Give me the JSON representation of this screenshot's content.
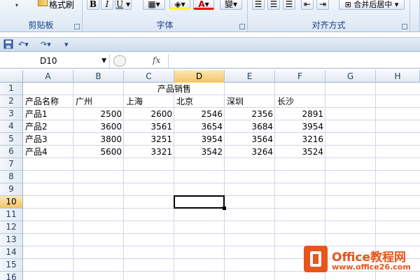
{
  "ribbon": {
    "clipboard_group": "剪贴板",
    "format_painter_label": "格式刷",
    "font_group": "字体",
    "align_group": "对齐方式",
    "merge_center_label": "合并后居中",
    "bold": "B",
    "italic": "I",
    "underline": "U",
    "font_color_letter": "A",
    "phonetic": "變"
  },
  "qat": {
    "save_icon": "save-icon",
    "undo_icon": "undo-icon",
    "redo_icon": "redo-icon"
  },
  "formula_bar": {
    "name_box": "D10",
    "fx_label": "fx",
    "formula": ""
  },
  "columns": [
    "A",
    "B",
    "C",
    "D",
    "E",
    "F",
    "G",
    "H"
  ],
  "rows": [
    "1",
    "2",
    "3",
    "4",
    "5",
    "6",
    "7",
    "8",
    "9",
    "10",
    "11",
    "12",
    "13",
    "14",
    "15",
    "16"
  ],
  "active_cell": {
    "column": "D",
    "row": "10"
  },
  "sheet": {
    "title": "产品销售",
    "header": [
      "产品名称",
      "广州",
      "上海",
      "北京",
      "深圳",
      "长沙"
    ],
    "data": [
      {
        "name": "产品1",
        "values": [
          "2500",
          "2600",
          "2546",
          "2356",
          "2891"
        ]
      },
      {
        "name": "产品2",
        "values": [
          "3600",
          "3561",
          "3654",
          "3684",
          "3954"
        ]
      },
      {
        "name": "产品3",
        "values": [
          "3800",
          "3251",
          "3954",
          "3564",
          "3216"
        ]
      },
      {
        "name": "产品4",
        "values": [
          "5600",
          "3321",
          "3542",
          "3264",
          "3524"
        ]
      }
    ]
  },
  "watermark": {
    "title": "Office教程网",
    "url": "www.office26.com"
  },
  "colors": {
    "ribbon_text": "#15428b",
    "active_header": "#f4c466",
    "watermark": "#e8541a"
  }
}
